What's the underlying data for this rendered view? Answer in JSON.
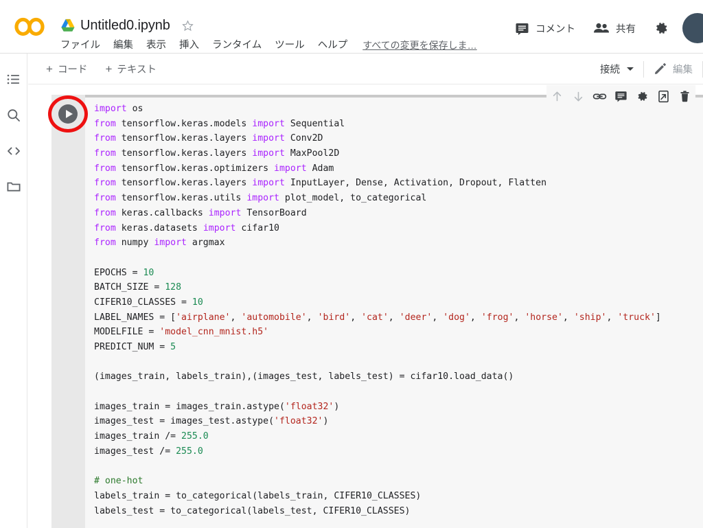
{
  "window": {
    "app": "Google Colaboratory",
    "brand_color": "#f9ab00"
  },
  "header": {
    "logo_name": "colab-logo",
    "drive_icon": "google-drive-icon",
    "notebook_title": "Untitled0.ipynb",
    "star_icon": "star-outline-icon",
    "menus": [
      "ファイル",
      "編集",
      "表示",
      "挿入",
      "ランタイム",
      "ツール",
      "ヘルプ"
    ],
    "save_status": "すべての変更を保存しま…",
    "comment_button": {
      "label": "コメント",
      "icon": "comment-icon"
    },
    "share_button": {
      "label": "共有",
      "icon": "people-icon"
    },
    "settings_icon": "gear-icon",
    "avatar": {
      "name": "avatar",
      "color": "#3e5060"
    }
  },
  "rail": {
    "items": [
      {
        "name": "table-of-contents",
        "icon": "list-icon"
      },
      {
        "name": "find-and-replace",
        "icon": "search-icon"
      },
      {
        "name": "code-snippets",
        "icon": "code-brackets-icon"
      },
      {
        "name": "files",
        "icon": "folder-icon"
      }
    ]
  },
  "notebook_toolbar": {
    "add_code": {
      "label": "コード",
      "plus": "+"
    },
    "add_text": {
      "label": "テキスト",
      "plus": "+"
    },
    "connect": {
      "label": "接続",
      "caret_icon": "caret-down-icon"
    },
    "edit": {
      "label": "編集",
      "icon": "pencil-icon"
    }
  },
  "cell": {
    "run_button": {
      "name": "run-cell-button",
      "icon": "play-icon"
    },
    "annotation": {
      "shape": "circle-highlight",
      "color": "#ee1111"
    },
    "actions": [
      {
        "name": "move-cell-up-button",
        "icon": "arrow-up-icon"
      },
      {
        "name": "move-cell-down-button",
        "icon": "arrow-down-icon"
      },
      {
        "name": "link-to-cell-button",
        "icon": "link-icon"
      },
      {
        "name": "add-comment-button",
        "icon": "comment-icon"
      },
      {
        "name": "cell-settings-button",
        "icon": "gear-icon"
      },
      {
        "name": "mirror-cell-button",
        "icon": "mirror-cell-icon"
      },
      {
        "name": "delete-cell-button",
        "icon": "trash-icon"
      }
    ],
    "code_lines": [
      [
        {
          "t": "import",
          "c": "kw"
        },
        {
          "t": " os",
          "c": ""
        }
      ],
      [
        {
          "t": "from",
          "c": "kw"
        },
        {
          "t": " tensorflow.keras.models ",
          "c": ""
        },
        {
          "t": "import",
          "c": "kw"
        },
        {
          "t": " Sequential",
          "c": ""
        }
      ],
      [
        {
          "t": "from",
          "c": "kw"
        },
        {
          "t": " tensorflow.keras.layers ",
          "c": ""
        },
        {
          "t": "import",
          "c": "kw"
        },
        {
          "t": " Conv2D",
          "c": ""
        }
      ],
      [
        {
          "t": "from",
          "c": "kw"
        },
        {
          "t": " tensorflow.keras.layers ",
          "c": ""
        },
        {
          "t": "import",
          "c": "kw"
        },
        {
          "t": " MaxPool2D",
          "c": ""
        }
      ],
      [
        {
          "t": "from",
          "c": "kw"
        },
        {
          "t": " tensorflow.keras.optimizers ",
          "c": ""
        },
        {
          "t": "import",
          "c": "kw"
        },
        {
          "t": " Adam",
          "c": ""
        }
      ],
      [
        {
          "t": "from",
          "c": "kw"
        },
        {
          "t": " tensorflow.keras.layers ",
          "c": ""
        },
        {
          "t": "import",
          "c": "kw"
        },
        {
          "t": " InputLayer, Dense, Activation, Dropout, Flatten",
          "c": ""
        }
      ],
      [
        {
          "t": "from",
          "c": "kw"
        },
        {
          "t": " tensorflow.keras.utils ",
          "c": ""
        },
        {
          "t": "import",
          "c": "kw"
        },
        {
          "t": " plot_model, to_categorical",
          "c": ""
        }
      ],
      [
        {
          "t": "from",
          "c": "kw"
        },
        {
          "t": " keras.callbacks ",
          "c": ""
        },
        {
          "t": "import",
          "c": "kw"
        },
        {
          "t": " TensorBoard",
          "c": ""
        }
      ],
      [
        {
          "t": "from",
          "c": "kw"
        },
        {
          "t": " keras.datasets ",
          "c": ""
        },
        {
          "t": "import",
          "c": "kw"
        },
        {
          "t": " cifar10",
          "c": ""
        }
      ],
      [
        {
          "t": "from",
          "c": "kw"
        },
        {
          "t": " numpy ",
          "c": ""
        },
        {
          "t": "import",
          "c": "kw"
        },
        {
          "t": " argmax",
          "c": ""
        }
      ],
      [],
      [
        {
          "t": "EPOCHS = ",
          "c": ""
        },
        {
          "t": "10",
          "c": "num"
        }
      ],
      [
        {
          "t": "BATCH_SIZE = ",
          "c": ""
        },
        {
          "t": "128",
          "c": "num"
        }
      ],
      [
        {
          "t": "CIFER10_CLASSES = ",
          "c": ""
        },
        {
          "t": "10",
          "c": "num"
        }
      ],
      [
        {
          "t": "LABEL_NAMES = [",
          "c": ""
        },
        {
          "t": "'airplane'",
          "c": "str"
        },
        {
          "t": ", ",
          "c": ""
        },
        {
          "t": "'automobile'",
          "c": "str"
        },
        {
          "t": ", ",
          "c": ""
        },
        {
          "t": "'bird'",
          "c": "str"
        },
        {
          "t": ", ",
          "c": ""
        },
        {
          "t": "'cat'",
          "c": "str"
        },
        {
          "t": ", ",
          "c": ""
        },
        {
          "t": "'deer'",
          "c": "str"
        },
        {
          "t": ", ",
          "c": ""
        },
        {
          "t": "'dog'",
          "c": "str"
        },
        {
          "t": ", ",
          "c": ""
        },
        {
          "t": "'frog'",
          "c": "str"
        },
        {
          "t": ", ",
          "c": ""
        },
        {
          "t": "'horse'",
          "c": "str"
        },
        {
          "t": ", ",
          "c": ""
        },
        {
          "t": "'ship'",
          "c": "str"
        },
        {
          "t": ", ",
          "c": ""
        },
        {
          "t": "'truck'",
          "c": "str"
        },
        {
          "t": "]",
          "c": ""
        }
      ],
      [
        {
          "t": "MODELFILE = ",
          "c": ""
        },
        {
          "t": "'model_cnn_mnist.h5'",
          "c": "str"
        }
      ],
      [
        {
          "t": "PREDICT_NUM = ",
          "c": ""
        },
        {
          "t": "5",
          "c": "num"
        }
      ],
      [],
      [
        {
          "t": "(images_train, labels_train),(images_test, labels_test) = cifar10.load_data()",
          "c": ""
        }
      ],
      [],
      [
        {
          "t": "images_train = images_train.astype(",
          "c": ""
        },
        {
          "t": "'float32'",
          "c": "str"
        },
        {
          "t": ")",
          "c": ""
        }
      ],
      [
        {
          "t": "images_test = images_test.astype(",
          "c": ""
        },
        {
          "t": "'float32'",
          "c": "str"
        },
        {
          "t": ")",
          "c": ""
        }
      ],
      [
        {
          "t": "images_train /= ",
          "c": ""
        },
        {
          "t": "255.0",
          "c": "num"
        }
      ],
      [
        {
          "t": "images_test /= ",
          "c": ""
        },
        {
          "t": "255.0",
          "c": "num"
        }
      ],
      [],
      [
        {
          "t": "# one-hot",
          "c": "cmt"
        }
      ],
      [
        {
          "t": "labels_train = to_categorical(labels_train, CIFER10_CLASSES)",
          "c": ""
        }
      ],
      [
        {
          "t": "labels_test = to_categorical(labels_test, CIFER10_CLASSES)",
          "c": ""
        }
      ]
    ]
  }
}
